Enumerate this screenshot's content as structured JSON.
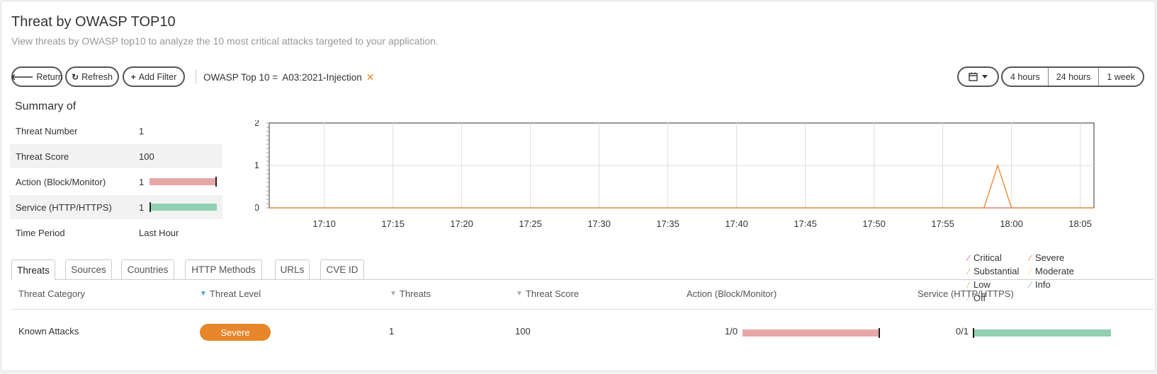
{
  "header": {
    "title": "Threat by OWASP TOP10",
    "subtitle": "View threats by OWASP top10 to analyze the 10 most critical attacks targeted to your application."
  },
  "toolbar": {
    "return_label": "Return",
    "refresh_label": "Refresh",
    "add_filter_label": "Add Filter",
    "filter_key": "OWASP Top 10 =",
    "filter_value": "A03:2021-Injection",
    "time_ranges": [
      "4 hours",
      "24 hours",
      "1 week"
    ]
  },
  "summary": {
    "title": "Summary of",
    "rows": [
      {
        "label": "Threat Number",
        "value": "1"
      },
      {
        "label": "Threat Score",
        "value": "100"
      },
      {
        "label": "Action (Block/Monitor)",
        "value": "1",
        "fraction": 1.0
      },
      {
        "label": "Service (HTTP/HTTPS)",
        "value": "1",
        "fraction": 0.0
      },
      {
        "label": "Time Period",
        "value": "Last Hour"
      }
    ]
  },
  "chart_data": {
    "type": "line",
    "x": [
      "17:06",
      "17:07",
      "17:08",
      "17:09",
      "17:10",
      "17:11",
      "17:12",
      "17:13",
      "17:14",
      "17:15",
      "17:16",
      "17:17",
      "17:18",
      "17:19",
      "17:20",
      "17:21",
      "17:22",
      "17:23",
      "17:24",
      "17:25",
      "17:26",
      "17:27",
      "17:28",
      "17:29",
      "17:30",
      "17:31",
      "17:32",
      "17:33",
      "17:34",
      "17:35",
      "17:36",
      "17:37",
      "17:38",
      "17:39",
      "17:40",
      "17:41",
      "17:42",
      "17:43",
      "17:44",
      "17:45",
      "17:46",
      "17:47",
      "17:48",
      "17:49",
      "17:50",
      "17:51",
      "17:52",
      "17:53",
      "17:54",
      "17:55",
      "17:56",
      "17:57",
      "17:58",
      "17:59",
      "18:00",
      "18:01",
      "18:02",
      "18:03",
      "18:04",
      "18:05",
      "18:06"
    ],
    "x_tick_labels": [
      "17:10",
      "17:15",
      "17:20",
      "17:25",
      "17:30",
      "17:35",
      "17:40",
      "17:45",
      "17:50",
      "17:55",
      "18:00",
      "18:05"
    ],
    "ylim": [
      0,
      2
    ],
    "y_ticks": [
      "0",
      "1",
      "2"
    ],
    "grid": true,
    "legend_position": "top-right",
    "series": [
      {
        "name": "Critical",
        "color": "#e06666",
        "values": [
          0,
          0,
          0,
          0,
          0,
          0,
          0,
          0,
          0,
          0,
          0,
          0,
          0,
          0,
          0,
          0,
          0,
          0,
          0,
          0,
          0,
          0,
          0,
          0,
          0,
          0,
          0,
          0,
          0,
          0,
          0,
          0,
          0,
          0,
          0,
          0,
          0,
          0,
          0,
          0,
          0,
          0,
          0,
          0,
          0,
          0,
          0,
          0,
          0,
          0,
          0,
          0,
          0,
          0,
          0,
          0,
          0,
          0,
          0,
          0,
          0
        ]
      },
      {
        "name": "Severe",
        "color": "#e8862a",
        "values": [
          0,
          0,
          0,
          0,
          0,
          0,
          0,
          0,
          0,
          0,
          0,
          0,
          0,
          0,
          0,
          0,
          0,
          0,
          0,
          0,
          0,
          0,
          0,
          0,
          0,
          0,
          0,
          0,
          0,
          0,
          0,
          0,
          0,
          0,
          0,
          0,
          0,
          0,
          0,
          0,
          0,
          0,
          0,
          0,
          0,
          0,
          0,
          0,
          0,
          0,
          0,
          0,
          0,
          1,
          0,
          0,
          0,
          0,
          0,
          0,
          0
        ]
      },
      {
        "name": "Substantial",
        "color": "#f0b04a",
        "values": []
      },
      {
        "name": "Moderate",
        "color": "#f3d47a",
        "values": []
      },
      {
        "name": "Low",
        "color": "#9ccc7a",
        "values": []
      },
      {
        "name": "Info",
        "color": "#6fb0e0",
        "values": []
      },
      {
        "name": "Off",
        "color": "#cccccc",
        "values": []
      }
    ]
  },
  "tabs": [
    "Threats",
    "Sources",
    "Countries",
    "HTTP Methods",
    "URLs",
    "CVE ID"
  ],
  "table": {
    "columns": [
      "Threat Category",
      "Threat Level",
      "Threats",
      "Threat Score",
      "Action (Block/Monitor)",
      "Service (HTTP/HTTPS)"
    ],
    "rows": [
      {
        "category": "Known Attacks",
        "level": "Severe",
        "threats": "1",
        "score": "100",
        "action": "1/0",
        "action_fraction": 1.0,
        "service": "0/1",
        "service_fraction": 0.0
      }
    ]
  }
}
